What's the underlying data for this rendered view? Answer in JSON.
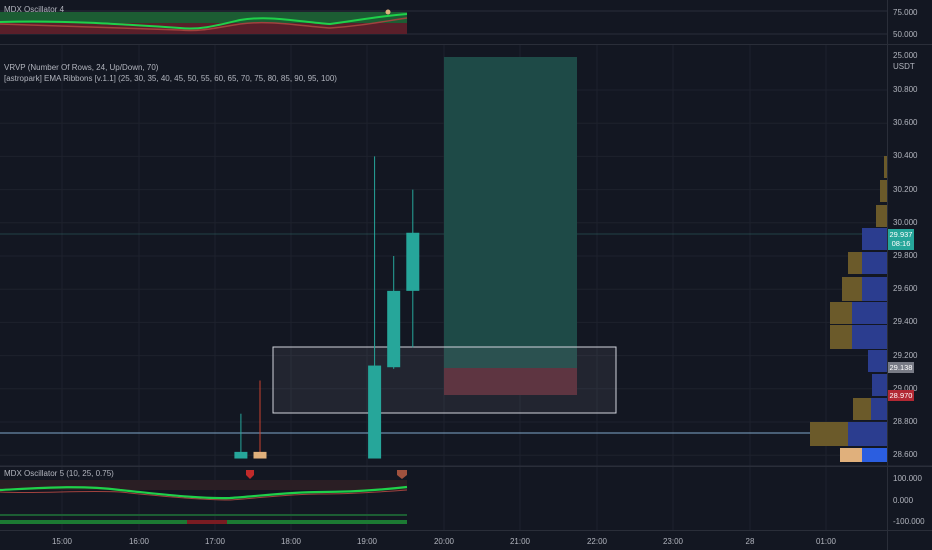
{
  "indicators": {
    "osc_top": "MDX Oscillator 4",
    "vrvp": "VRVP (Number Of Rows, 24, Up/Down, 70)",
    "ema": "[astropark] EMA Ribbons [v.1.1] (25, 30, 35, 40, 45, 50, 55, 60, 65, 70, 75, 80, 85, 90, 95, 100)",
    "osc_bottom": "MDX Oscillator 5 (10, 25, 0.75)"
  },
  "top_pane_scale": [
    "75.000",
    "50.000",
    "25.000"
  ],
  "currency": "USDT",
  "price_scale": [
    "30.800",
    "30.600",
    "30.400",
    "30.200",
    "30.000",
    "29.800",
    "29.600",
    "29.400",
    "29.200",
    "29.000",
    "28.800",
    "28.600"
  ],
  "price_tags": {
    "last": "29.937",
    "countdown": "08:16",
    "grey": "29.138",
    "red": "28.970"
  },
  "bottom_pane_scale": [
    "100.000",
    "0.000",
    "-100.000"
  ],
  "time_scale": [
    "15:00",
    "16:00",
    "17:00",
    "18:00",
    "19:00",
    "20:00",
    "21:00",
    "22:00",
    "23:00",
    "28",
    "01:00"
  ],
  "colors": {
    "background": "#131722",
    "bull": "#26a69a",
    "bear": "#e0b07c",
    "position_target": "#1e4a47",
    "position_stop": "#5a2a36",
    "volume_up": "#2b3d8f",
    "volume_down": "#6b5a2a",
    "last_price": "#26a69a",
    "red_tag": "#b22833"
  },
  "chart_data": {
    "type": "candlestick",
    "candles": [
      {
        "time": "17:15",
        "open": 28.58,
        "high": 28.85,
        "low": 28.58,
        "close": 28.62
      },
      {
        "time": "17:30",
        "open": 28.62,
        "high": 29.05,
        "low": 28.58,
        "close": 28.58
      },
      {
        "time": "19:00",
        "open": 28.58,
        "high": 30.4,
        "low": 28.58,
        "close": 29.14
      },
      {
        "time": "19:15",
        "open": 29.13,
        "high": 29.8,
        "low": 29.12,
        "close": 29.59
      },
      {
        "time": "19:30",
        "open": 29.59,
        "high": 30.2,
        "low": 29.25,
        "close": 29.94
      }
    ],
    "ylim": [
      28.6,
      30.8
    ]
  }
}
